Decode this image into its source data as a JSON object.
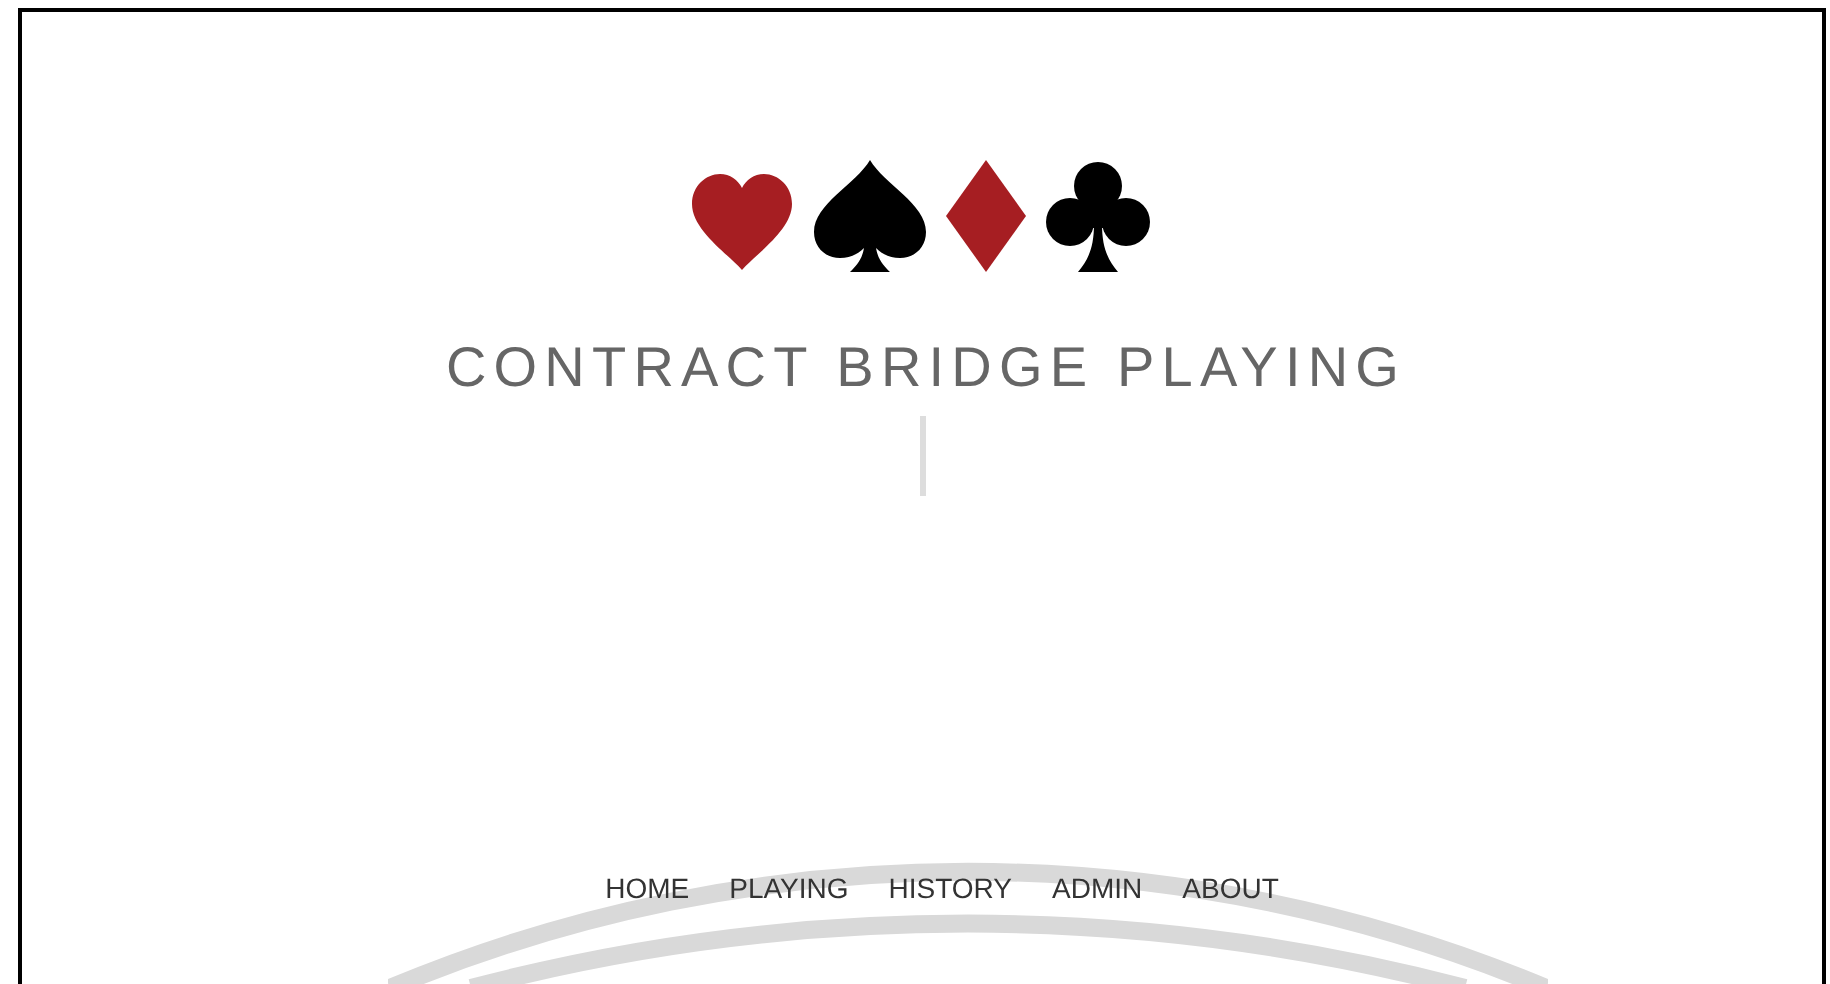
{
  "logo": {
    "suits": [
      {
        "kind": "heart",
        "color": "#a61e22"
      },
      {
        "kind": "spade",
        "color": "#000000"
      },
      {
        "kind": "diamond",
        "color": "#a61e22"
      },
      {
        "kind": "club",
        "color": "#000000"
      }
    ]
  },
  "title": "CONTRACT BRIDGE PLAYING",
  "nav": [
    {
      "label": "HOME"
    },
    {
      "label": "PLAYING"
    },
    {
      "label": "HISTORY"
    },
    {
      "label": "ADMIN"
    },
    {
      "label": "ABOUT"
    }
  ]
}
